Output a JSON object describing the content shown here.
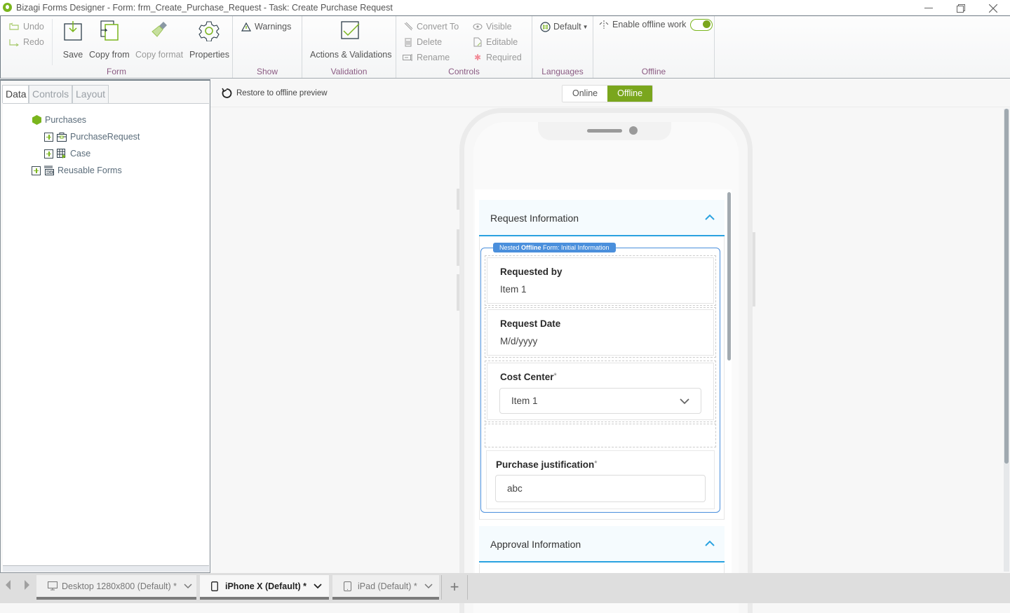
{
  "window": {
    "title": "Bizagi Forms Designer  - Form: frm_Create_Purchase_Request - Task:  Create Purchase Request",
    "controls": {
      "minimize": "—",
      "restore": "❐",
      "close": "✕"
    }
  },
  "ribbon": {
    "groups": {
      "form": {
        "label": "Form",
        "undo": "Undo",
        "redo": "Redo",
        "save": "Save",
        "copy_from": "Copy from",
        "copy_format": "Copy format",
        "properties": "Properties"
      },
      "show": {
        "label": "Show",
        "warnings": "Warnings"
      },
      "validation": {
        "label": "Validation",
        "actions_validations": "Actions & Validations"
      },
      "controls": {
        "label": "Controls",
        "convert_to": "Convert To",
        "delete": "Delete",
        "rename": "Rename",
        "visible": "Visible",
        "editable": "Editable",
        "required": "Required"
      },
      "languages": {
        "label": "Languages",
        "selected": "Default"
      },
      "offline": {
        "label": "Offline",
        "enable_offline": "Enable offline work",
        "enabled": true
      }
    }
  },
  "left_panel": {
    "tabs": [
      {
        "label": "Data",
        "active": true
      },
      {
        "label": "Controls",
        "active": false
      },
      {
        "label": "Layout",
        "active": false
      }
    ],
    "tree": {
      "root": "Purchases",
      "children": [
        {
          "label": "PurchaseRequest",
          "icon": "entity-icon"
        },
        {
          "label": "Case",
          "icon": "case-table-icon"
        }
      ],
      "reusable": "Reusable Forms"
    }
  },
  "canvas": {
    "restore_label": "Restore to offline preview",
    "modes": [
      {
        "label": "Online",
        "active": false
      },
      {
        "label": "Offline",
        "active": true
      }
    ]
  },
  "form": {
    "sections": [
      {
        "title": "Request Information",
        "expanded": true
      },
      {
        "title": "Approval Information",
        "expanded": true
      }
    ],
    "nested_tag": {
      "prefix": "Nested ",
      "bold": "Offline",
      "suffix": " Form: Initial Information"
    },
    "fields": {
      "requested_by": {
        "label": "Requested by",
        "value": "Item 1"
      },
      "request_date": {
        "label": "Request Date",
        "value": "M/d/yyyy"
      },
      "cost_center": {
        "label": "Cost Center",
        "required_mark": "*",
        "value": "Item 1"
      },
      "purchase_justification": {
        "label": "Purchase justification",
        "required_mark": "*",
        "value": "abc"
      }
    }
  },
  "device_tabs": [
    {
      "label": "Desktop 1280x800 (Default)",
      "modified": "*",
      "active": false
    },
    {
      "label": "iPhone X (Default)",
      "modified": "*",
      "active": true
    },
    {
      "label": "iPad (Default)",
      "modified": "*",
      "active": false
    }
  ],
  "add_tab": "+",
  "colors": {
    "brand_green": "#7ab51d",
    "offline_active": "#7aa61d",
    "section_accent": "#2aa2e0",
    "nested_border": "#4a8fdc",
    "group_label": "#8a5a82"
  }
}
